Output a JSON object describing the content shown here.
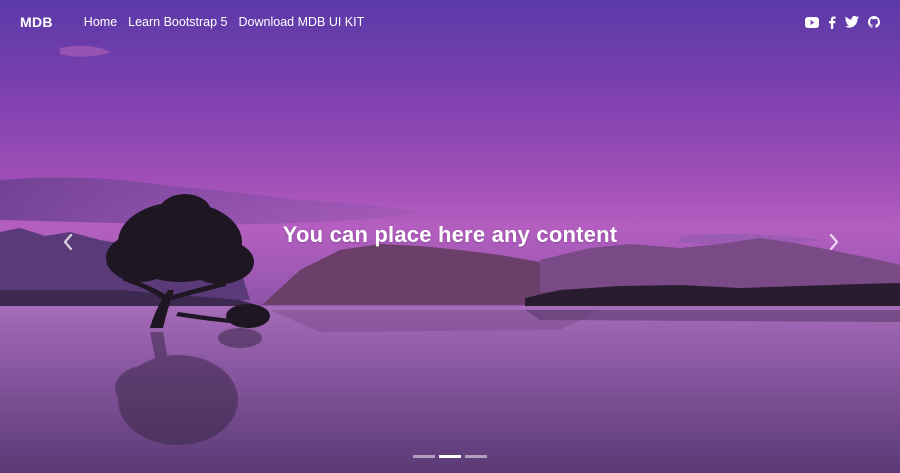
{
  "navbar": {
    "brand": "MDB",
    "links": [
      {
        "label": "Home"
      },
      {
        "label": "Learn Bootstrap 5"
      },
      {
        "label": "Download MDB UI KIT"
      }
    ],
    "social_icons": [
      "youtube-icon",
      "facebook-icon",
      "twitter-icon",
      "github-icon"
    ]
  },
  "carousel": {
    "caption": "You can place here any content",
    "prev_icon": "chevron-left-icon",
    "next_icon": "chevron-right-icon",
    "slide_count": 3,
    "active_slide": 2
  },
  "colors": {
    "sky_top": "#5b3aa8",
    "sky_mid": "#b45fc0",
    "water": "#8e54a8",
    "text": "#ffffff"
  }
}
